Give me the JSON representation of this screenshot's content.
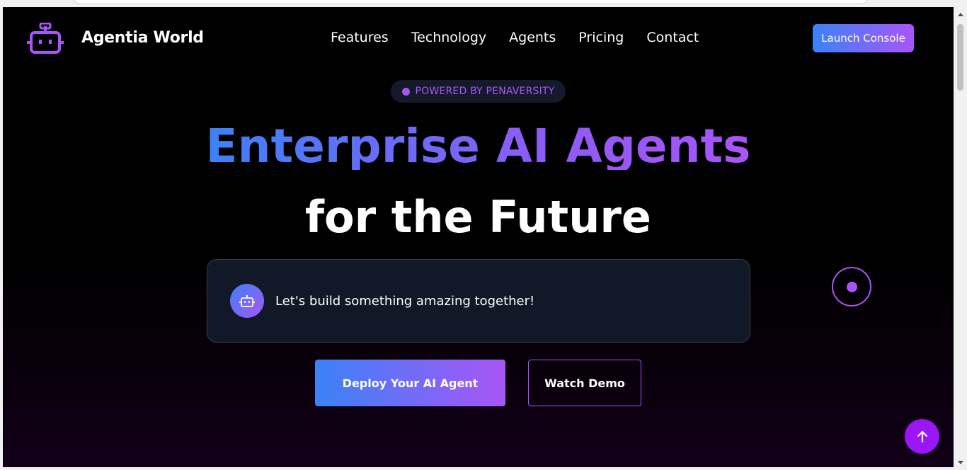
{
  "header": {
    "brand": "Agentia World",
    "nav": [
      "Features",
      "Technology",
      "Agents",
      "Pricing",
      "Contact"
    ],
    "launch_label": "Launch Console"
  },
  "hero": {
    "badge": "POWERED BY PENAVERSITY",
    "title_gradient": "Enterprise AI Agents",
    "title_line2": "for the Future",
    "chat_message": "Let's build something amazing together!",
    "primary_cta": "Deploy Your AI Agent",
    "secondary_cta": "Watch Demo"
  },
  "colors": {
    "accent_blue": "#3b82f6",
    "accent_purple": "#a855f7",
    "background": "#000000"
  },
  "icons": {
    "logo": "robot-icon",
    "chat_avatar": "robot-icon",
    "scroll_top": "arrow-up-icon"
  }
}
